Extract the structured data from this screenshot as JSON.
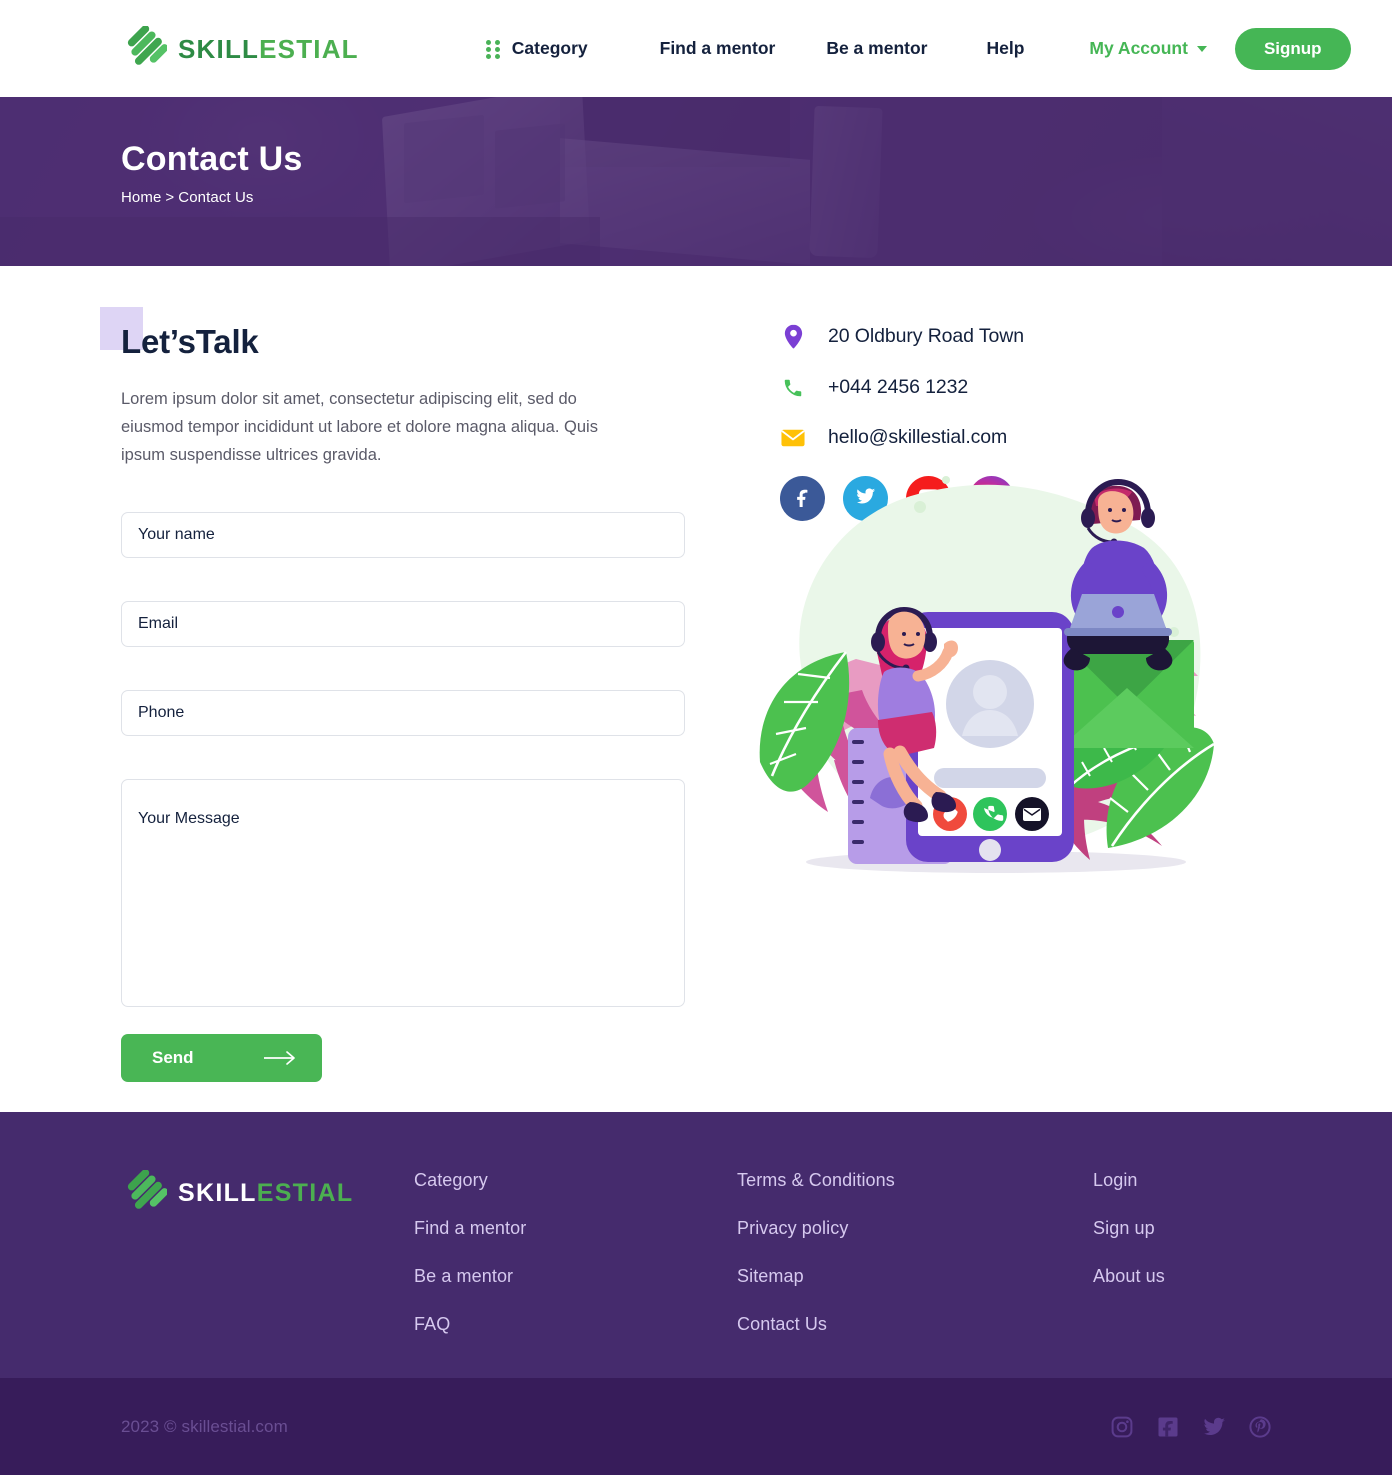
{
  "brand": {
    "name_part1": "SKILL",
    "name_part2": "ESTIAL",
    "logo_icon": "skillestial-chevron-logo",
    "green_dark": "#2e8b45",
    "green_light": "#4caf50"
  },
  "header": {
    "nav": [
      {
        "label": "Category",
        "icon": "grid-dots-icon"
      },
      {
        "label": "Find a mentor"
      },
      {
        "label": "Be a mentor"
      },
      {
        "label": "Help"
      }
    ],
    "account_label": "My Account",
    "account_caret_icon": "chevron-down-icon",
    "signup_label": "Signup",
    "accent_green": "#45b655"
  },
  "hero": {
    "title": "Contact Us",
    "breadcrumb_home": "Home",
    "breadcrumb_sep": ">",
    "breadcrumb_current": "Contact Us",
    "overlay_color": "#4e2e73"
  },
  "contact_section": {
    "heading": "Let’sTalk",
    "highlight_color": "#ded5f5",
    "description": "Lorem ipsum dolor sit amet, consectetur adipiscing elit, sed do eiusmod tempor incididunt ut labore et dolore magna aliqua. Quis ipsum suspendisse ultrices gravida.",
    "form": {
      "name_placeholder": "Your name",
      "email_placeholder": "Email",
      "phone_placeholder": "Phone",
      "message_placeholder": "Your Message",
      "submit_label": "Send",
      "submit_icon": "arrow-right-icon",
      "submit_color": "#49b655"
    },
    "info": [
      {
        "icon": "location-pin-icon",
        "text": "20 Oldbury Road Town",
        "color": "#7b3fd4"
      },
      {
        "icon": "phone-icon",
        "text": "+044 2456 1232",
        "color": "#47c15a"
      },
      {
        "icon": "envelope-icon",
        "text": "hello@skillestial.com",
        "color": "#ffc107"
      }
    ],
    "socials": [
      {
        "icon": "facebook-icon",
        "color": "#3b5998"
      },
      {
        "icon": "twitter-icon",
        "color": "#2aa9e0"
      },
      {
        "icon": "youtube-icon",
        "color": "#f51d1d"
      },
      {
        "icon": "instagram-icon",
        "color": "#e7245e"
      }
    ],
    "illustration": "contact-support-phone-illustration"
  },
  "footer": {
    "bg_color": "#452b6d",
    "columns": [
      {
        "links": [
          "Category",
          "Find a mentor",
          "Be a mentor",
          "FAQ"
        ]
      },
      {
        "links": [
          "Terms & Conditions",
          "Privacy policy",
          "Sitemap",
          "Contact Us"
        ]
      },
      {
        "links": [
          "Login",
          "Sign up",
          "About us"
        ]
      }
    ],
    "bottom": {
      "copyright": "2023 © skillestial.com",
      "bg_color": "#371c5a",
      "socials": [
        {
          "icon": "instagram-icon"
        },
        {
          "icon": "facebook-icon"
        },
        {
          "icon": "twitter-icon"
        },
        {
          "icon": "pinterest-icon"
        }
      ]
    }
  }
}
